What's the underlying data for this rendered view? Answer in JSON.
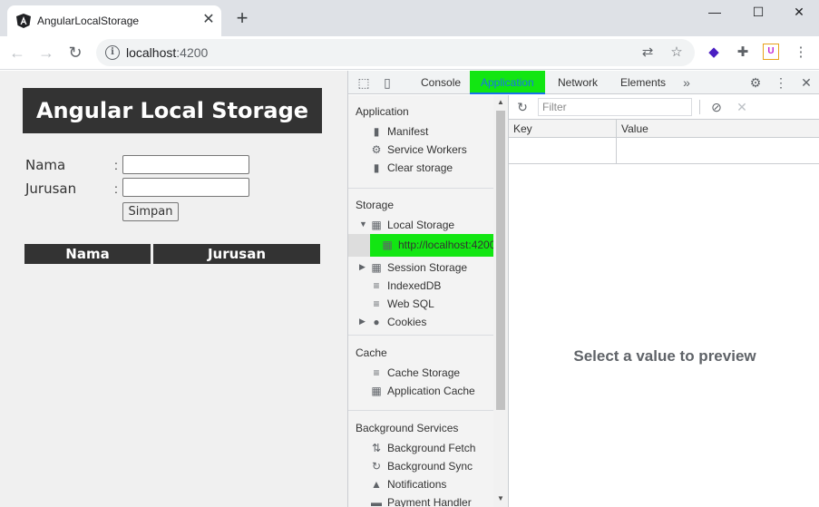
{
  "browser": {
    "tab_title": "AngularLocalStorage",
    "tab_close": "✕",
    "new_tab": "+",
    "win_minimize": "—",
    "win_maximize": "☐",
    "win_close": "✕",
    "url_host": "localhost",
    "url_port": ":4200",
    "info_icon": "i"
  },
  "page": {
    "title": "Angular Local Storage",
    "nama_label": "Nama",
    "jurusan_label": "Jurusan",
    "colon": ":",
    "nama_value": "",
    "jurusan_value": "",
    "simpan_label": "Simpan",
    "table_headers": [
      "Nama",
      "Jurusan"
    ]
  },
  "devtools": {
    "tabs": [
      "Console",
      "Application",
      "Network",
      "Elements"
    ],
    "active_tab": "Application",
    "more_tabs": "»",
    "sidebar": {
      "application_title": "Application",
      "application_items": [
        "Manifest",
        "Service Workers",
        "Clear storage"
      ],
      "storage_title": "Storage",
      "storage_items": [
        "Local Storage",
        "http://localhost:4200",
        "Session Storage",
        "IndexedDB",
        "Web SQL",
        "Cookies"
      ],
      "cache_title": "Cache",
      "cache_items": [
        "Cache Storage",
        "Application Cache"
      ],
      "bg_title": "Background Services",
      "bg_items": [
        "Background Fetch",
        "Background Sync",
        "Notifications",
        "Payment Handler"
      ]
    },
    "filter_placeholder": "Filter",
    "grid_headers": [
      "Key",
      "Value"
    ],
    "preview_text": "Select a value to preview",
    "highlight_color": "#12e612"
  }
}
